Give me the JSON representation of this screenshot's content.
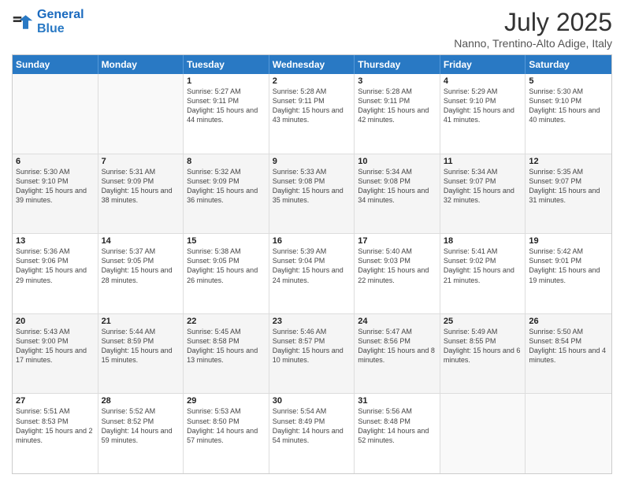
{
  "logo": {
    "line1": "General",
    "line2": "Blue"
  },
  "title": "July 2025",
  "subtitle": "Nanno, Trentino-Alto Adige, Italy",
  "weekdays": [
    "Sunday",
    "Monday",
    "Tuesday",
    "Wednesday",
    "Thursday",
    "Friday",
    "Saturday"
  ],
  "rows": [
    [
      {
        "day": "",
        "info": ""
      },
      {
        "day": "",
        "info": ""
      },
      {
        "day": "1",
        "info": "Sunrise: 5:27 AM\nSunset: 9:11 PM\nDaylight: 15 hours and 44 minutes."
      },
      {
        "day": "2",
        "info": "Sunrise: 5:28 AM\nSunset: 9:11 PM\nDaylight: 15 hours and 43 minutes."
      },
      {
        "day": "3",
        "info": "Sunrise: 5:28 AM\nSunset: 9:11 PM\nDaylight: 15 hours and 42 minutes."
      },
      {
        "day": "4",
        "info": "Sunrise: 5:29 AM\nSunset: 9:10 PM\nDaylight: 15 hours and 41 minutes."
      },
      {
        "day": "5",
        "info": "Sunrise: 5:30 AM\nSunset: 9:10 PM\nDaylight: 15 hours and 40 minutes."
      }
    ],
    [
      {
        "day": "6",
        "info": "Sunrise: 5:30 AM\nSunset: 9:10 PM\nDaylight: 15 hours and 39 minutes."
      },
      {
        "day": "7",
        "info": "Sunrise: 5:31 AM\nSunset: 9:09 PM\nDaylight: 15 hours and 38 minutes."
      },
      {
        "day": "8",
        "info": "Sunrise: 5:32 AM\nSunset: 9:09 PM\nDaylight: 15 hours and 36 minutes."
      },
      {
        "day": "9",
        "info": "Sunrise: 5:33 AM\nSunset: 9:08 PM\nDaylight: 15 hours and 35 minutes."
      },
      {
        "day": "10",
        "info": "Sunrise: 5:34 AM\nSunset: 9:08 PM\nDaylight: 15 hours and 34 minutes."
      },
      {
        "day": "11",
        "info": "Sunrise: 5:34 AM\nSunset: 9:07 PM\nDaylight: 15 hours and 32 minutes."
      },
      {
        "day": "12",
        "info": "Sunrise: 5:35 AM\nSunset: 9:07 PM\nDaylight: 15 hours and 31 minutes."
      }
    ],
    [
      {
        "day": "13",
        "info": "Sunrise: 5:36 AM\nSunset: 9:06 PM\nDaylight: 15 hours and 29 minutes."
      },
      {
        "day": "14",
        "info": "Sunrise: 5:37 AM\nSunset: 9:05 PM\nDaylight: 15 hours and 28 minutes."
      },
      {
        "day": "15",
        "info": "Sunrise: 5:38 AM\nSunset: 9:05 PM\nDaylight: 15 hours and 26 minutes."
      },
      {
        "day": "16",
        "info": "Sunrise: 5:39 AM\nSunset: 9:04 PM\nDaylight: 15 hours and 24 minutes."
      },
      {
        "day": "17",
        "info": "Sunrise: 5:40 AM\nSunset: 9:03 PM\nDaylight: 15 hours and 22 minutes."
      },
      {
        "day": "18",
        "info": "Sunrise: 5:41 AM\nSunset: 9:02 PM\nDaylight: 15 hours and 21 minutes."
      },
      {
        "day": "19",
        "info": "Sunrise: 5:42 AM\nSunset: 9:01 PM\nDaylight: 15 hours and 19 minutes."
      }
    ],
    [
      {
        "day": "20",
        "info": "Sunrise: 5:43 AM\nSunset: 9:00 PM\nDaylight: 15 hours and 17 minutes."
      },
      {
        "day": "21",
        "info": "Sunrise: 5:44 AM\nSunset: 8:59 PM\nDaylight: 15 hours and 15 minutes."
      },
      {
        "day": "22",
        "info": "Sunrise: 5:45 AM\nSunset: 8:58 PM\nDaylight: 15 hours and 13 minutes."
      },
      {
        "day": "23",
        "info": "Sunrise: 5:46 AM\nSunset: 8:57 PM\nDaylight: 15 hours and 10 minutes."
      },
      {
        "day": "24",
        "info": "Sunrise: 5:47 AM\nSunset: 8:56 PM\nDaylight: 15 hours and 8 minutes."
      },
      {
        "day": "25",
        "info": "Sunrise: 5:49 AM\nSunset: 8:55 PM\nDaylight: 15 hours and 6 minutes."
      },
      {
        "day": "26",
        "info": "Sunrise: 5:50 AM\nSunset: 8:54 PM\nDaylight: 15 hours and 4 minutes."
      }
    ],
    [
      {
        "day": "27",
        "info": "Sunrise: 5:51 AM\nSunset: 8:53 PM\nDaylight: 15 hours and 2 minutes."
      },
      {
        "day": "28",
        "info": "Sunrise: 5:52 AM\nSunset: 8:52 PM\nDaylight: 14 hours and 59 minutes."
      },
      {
        "day": "29",
        "info": "Sunrise: 5:53 AM\nSunset: 8:50 PM\nDaylight: 14 hours and 57 minutes."
      },
      {
        "day": "30",
        "info": "Sunrise: 5:54 AM\nSunset: 8:49 PM\nDaylight: 14 hours and 54 minutes."
      },
      {
        "day": "31",
        "info": "Sunrise: 5:56 AM\nSunset: 8:48 PM\nDaylight: 14 hours and 52 minutes."
      },
      {
        "day": "",
        "info": ""
      },
      {
        "day": "",
        "info": ""
      }
    ]
  ]
}
